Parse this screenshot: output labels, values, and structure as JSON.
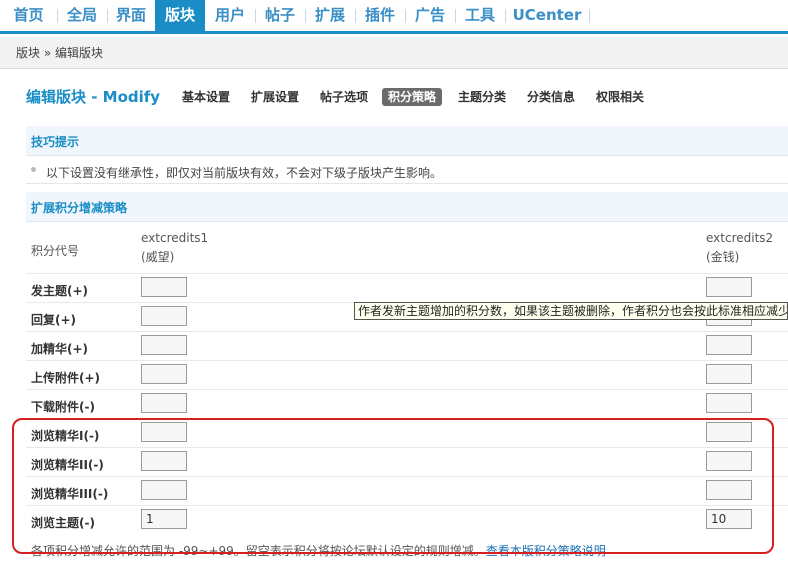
{
  "nav": {
    "items": [
      "首页",
      "全局",
      "界面",
      "版块",
      "用户",
      "帖子",
      "扩展",
      "插件",
      "广告",
      "工具",
      "UCenter"
    ],
    "active": "版块",
    "accent_color": "#1a8dc7"
  },
  "breadcrumb": {
    "text": "版块 » 编辑版块"
  },
  "page": {
    "title": "编辑版块 - Modify",
    "tabs": [
      "基本设置",
      "扩展设置",
      "帖子选项",
      "积分策略",
      "主题分类",
      "分类信息",
      "权限相关"
    ],
    "active_tab": "积分策略"
  },
  "tips": {
    "header": "技巧提示",
    "text": "以下设置没有继承性，即仅对当前版块有效，不会对下级子版块产生影响。"
  },
  "strategy": {
    "header": "扩展积分增减策略",
    "code_label": "积分代号",
    "columns": [
      {
        "code": "extcredits1",
        "name": "(威望)"
      },
      {
        "code": "extcredits2",
        "name": "(金钱)"
      }
    ],
    "rows": [
      {
        "label": "发主题(+)",
        "values": [
          "",
          ""
        ]
      },
      {
        "label": "回复(+)",
        "values": [
          "",
          ""
        ]
      },
      {
        "label": "加精华(+)",
        "values": [
          "",
          ""
        ]
      },
      {
        "label": "上传附件(+)",
        "values": [
          "",
          ""
        ]
      },
      {
        "label": "下载附件(-)",
        "values": [
          "",
          ""
        ]
      },
      {
        "label": "浏览精华I(-)",
        "values": [
          "",
          ""
        ]
      },
      {
        "label": "浏览精华II(-)",
        "values": [
          "",
          ""
        ]
      },
      {
        "label": "浏览精华III(-)",
        "values": [
          "",
          ""
        ]
      },
      {
        "label": "浏览主题(-)",
        "values": [
          "1",
          "10"
        ]
      }
    ],
    "tooltip": "作者发新主题增加的积分数，如果该主题被删除，作者积分也会按此标准相应减少",
    "footnote": "各项积分增减允许的范围为 -99~+99。留空表示积分将按论坛默认设定的规则增减。",
    "footnote_link": "查看本版积分策略说明"
  },
  "annotation": {
    "highlight_color": "#d61f1f"
  }
}
